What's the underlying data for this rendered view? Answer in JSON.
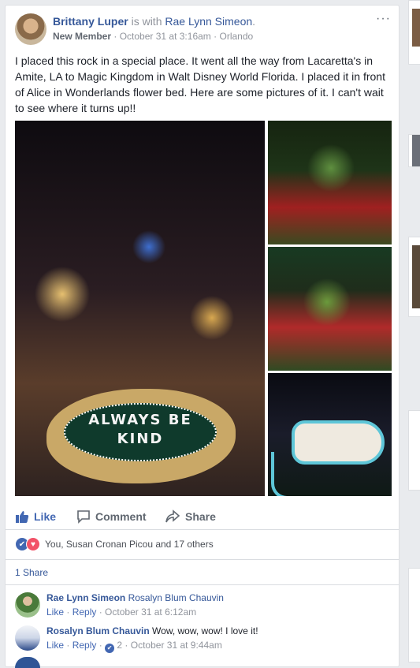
{
  "post": {
    "author": "Brittany Luper",
    "with_text": "is with",
    "tagged": "Rae Lynn Simeon",
    "period": ".",
    "badge": "New Member",
    "separator": "·",
    "timestamp": "October 31 at 3:16am",
    "location": "Orlando",
    "more": "···",
    "text": "I placed this rock in a special place. It went all the way from Lacaretta's in Amite, LA to Magic Kingdom in Walt Disney World Florida. I placed it in front of Alice in Wonderlands flower bed. Here are some pictures of it. I can't wait to see where it turns up!!",
    "rock_text_line1": "ALWAYS BE",
    "rock_text_line2": "KIND"
  },
  "actions": {
    "like": "Like",
    "comment": "Comment",
    "share": "Share"
  },
  "reactions": {
    "summary": "You, Susan Cronan Picou and 17 others"
  },
  "shares": {
    "label": "1 Share"
  },
  "comments": [
    {
      "author": "Rae Lynn Simeon",
      "text": "Rosalyn Blum Chauvin",
      "like": "Like",
      "reply": "Reply",
      "timestamp": "October 31 at 6:12am",
      "like_count": ""
    },
    {
      "author": "Rosalyn Blum Chauvin",
      "text": "Wow, wow, wow! I love it!",
      "like": "Like",
      "reply": "Reply",
      "timestamp": "October 31 at 9:44am",
      "like_count": "2"
    }
  ],
  "colors": {
    "link": "#365899",
    "like_blue": "#4267b2",
    "love_red": "#f25268",
    "page_bg": "#e9ebee"
  }
}
